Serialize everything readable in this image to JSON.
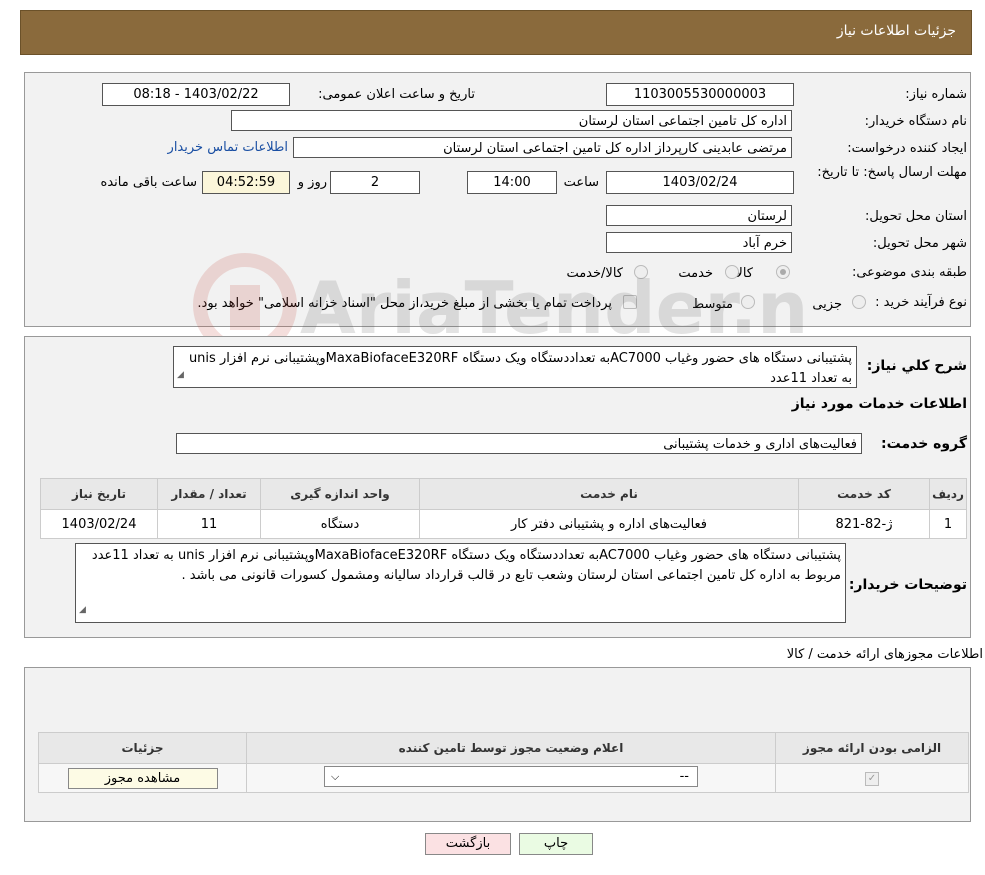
{
  "header": {
    "title": "جزئیات اطلاعات نیاز"
  },
  "form": {
    "need_number_label": "شماره نیاز:",
    "need_number": "1103005530000003",
    "announce_label": "تاریخ و ساعت اعلان عمومی:",
    "announce_value": "1403/02/22 - 08:18",
    "buyer_org_label": "نام دستگاه خریدار:",
    "buyer_org": "اداره کل تامین اجتماعی استان لرستان",
    "creator_label": "ایجاد کننده درخواست:",
    "creator": "مرتضی عابدینی کارپرداز اداره کل تامین اجتماعی استان لرستان",
    "contact_link": "اطلاعات تماس خریدار",
    "deadline_label": "مهلت ارسال پاسخ: تا تاریخ:",
    "deadline_date": "1403/02/24",
    "time_label": "ساعت",
    "deadline_time": "14:00",
    "days_value": "2",
    "days_label": "روز و",
    "remaining_time": "04:52:59",
    "remaining_label": "ساعت باقی مانده",
    "province_label": "استان محل تحویل:",
    "province": "لرستان",
    "city_label": "شهر محل تحویل:",
    "city": "خرم آباد",
    "category_label": "طبقه بندی موضوعی:",
    "category_options": [
      {
        "label": "کالا",
        "selected": true
      },
      {
        "label": "خدمت",
        "selected": false
      },
      {
        "label": "کالا/خدمت",
        "selected": false
      }
    ],
    "purchase_type_label": "نوع فرآیند خرید :",
    "purchase_options": [
      {
        "label": "جزیی",
        "selected": false
      },
      {
        "label": "متوسط",
        "selected": false
      }
    ],
    "payment_note": "پرداخت تمام یا بخشی از مبلغ خرید،از محل \"اسناد خزانه اسلامی\" خواهد بود."
  },
  "summary": {
    "label": "شرح کلي نياز:",
    "text": "پشتیبانی دستگاه های حضور وغیاب AC7000به تعداددستگاه ویک دستگاه MaxaBiofaceE320RFوپشتیبانی نرم افزار unis به تعداد 11عدد",
    "services_title": "اطلاعات خدمات مورد نیاز",
    "service_group_label": "گروه خدمت:",
    "service_group": "فعالیت‌های اداری و خدمات پشتیبانی"
  },
  "services_table": {
    "headers": [
      "ردیف",
      "کد خدمت",
      "نام خدمت",
      "واحد اندازه گیری",
      "تعداد / مقدار",
      "تاریخ نیاز"
    ],
    "rows": [
      [
        "1",
        "ژ-82-821",
        "فعالیت‌های اداره و پشتیبانی دفتر کار",
        "دستگاه",
        "11",
        "1403/02/24"
      ]
    ]
  },
  "buyer_notes": {
    "label": "توضیحات خریدار:",
    "text": "پشتیبانی دستگاه های حضور وغیاب AC7000به تعداددستگاه ویک دستگاه MaxaBiofaceE320RFوپشتیبانی نرم افزار unis به تعداد 11عدد مربوط به اداره کل تامین اجتماعی استان لرستان وشعب تابع در قالب قرارداد سالیانه ومشمول کسورات قانونی می باشد ."
  },
  "permits": {
    "title": "اطلاعات مجوزهای ارائه خدمت / کالا",
    "headers": [
      "الزامی بودن ارائه مجوز",
      "اعلام وضعیت مجوز توسط تامین کننده",
      "جزئیات"
    ],
    "row": {
      "required_checked": true,
      "status_value": "--",
      "details_button": "مشاهده مجوز"
    }
  },
  "footer": {
    "print_button": "چاپ",
    "back_button": "بازگشت"
  },
  "watermark": {
    "text": "AriaTender.net"
  }
}
